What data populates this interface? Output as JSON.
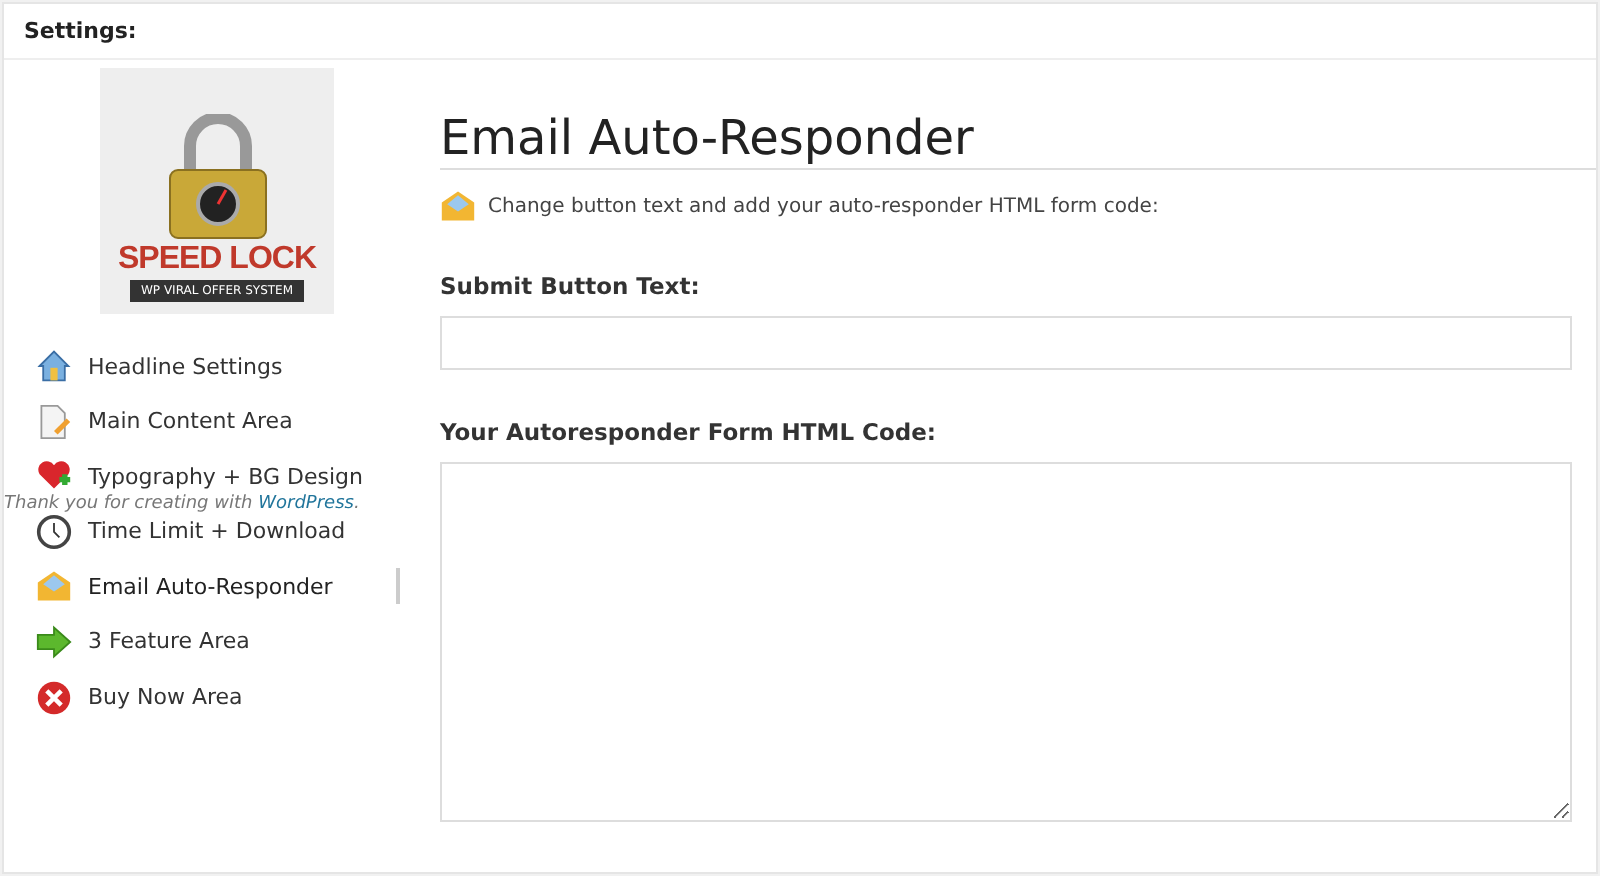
{
  "panel": {
    "title": "Settings:"
  },
  "logo": {
    "title": "SPEED LOCK",
    "subtitle": "WP VIRAL OFFER SYSTEM"
  },
  "sidebar": {
    "items": [
      {
        "label": "Headline Settings",
        "kind": "house",
        "selected": false
      },
      {
        "label": "Main Content Area",
        "kind": "document",
        "selected": false
      },
      {
        "label": "Typography + BG Design",
        "kind": "heart",
        "selected": false
      },
      {
        "label": "Time Limit + Download",
        "kind": "clock",
        "selected": false
      },
      {
        "label": "Email Auto-Responder",
        "kind": "envelope",
        "selected": true
      },
      {
        "label": "3 Feature Area",
        "kind": "arrow",
        "selected": false
      },
      {
        "label": "Buy Now Area",
        "kind": "cross",
        "selected": false
      }
    ]
  },
  "footer": {
    "text": "Thank you for creating with",
    "link": "WordPress",
    "end": "."
  },
  "content": {
    "heading": "Email Auto-Responder",
    "note": "Change button text and add your auto-responder HTML form code:",
    "fields": [
      {
        "label": "Submit Button Text:",
        "kind": "input"
      },
      {
        "label": "Your Autoresponder Form HTML Code:",
        "kind": "textarea"
      }
    ]
  }
}
